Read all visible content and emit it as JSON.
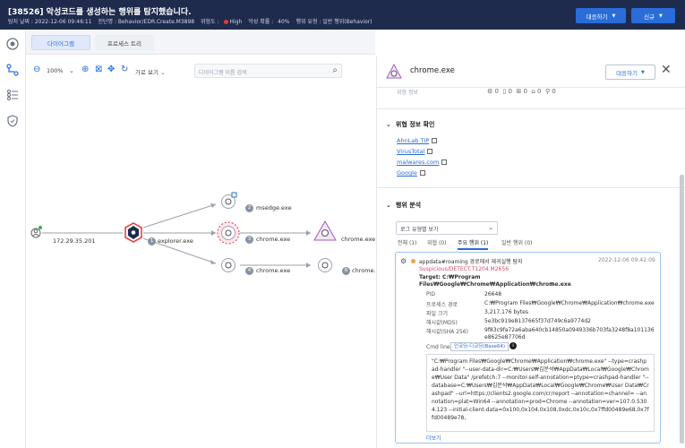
{
  "header": {
    "title": "[38526] 악성코드를 생성하는 행위를 탐지했습니다.",
    "meta": {
      "detect_time": "탐지 날짜 : 2022-12-06 09:46:11",
      "diagnosis": "진단명 : Behavior/EDR.Create.M3898",
      "risk_label": "위험도 :",
      "risk_value": "High",
      "probability_label": "악성 확률 :",
      "probability_value": "40%",
      "behavior_type": "행위 유형 : 일반 행위(Behavior)"
    },
    "next_button": "대응하기",
    "new_button": "신규"
  },
  "tabs": [
    "다이어그램",
    "프로세스 트리"
  ],
  "toolbar": {
    "zoom": "100%",
    "layout": "가로 보기",
    "search_placeholder": "다이어그램 이름 검색"
  },
  "graph": {
    "ip": "172.29.35.201",
    "nodes": [
      {
        "num": "1",
        "label": "explorer.exe"
      },
      {
        "num": "2",
        "label": "msedge.exe"
      },
      {
        "num": "3",
        "label": "chrome.exe"
      },
      {
        "num": "4",
        "label": "chrome.exe"
      },
      {
        "num": "5",
        "label": "chrome.exe"
      },
      {
        "num": "6",
        "label": "chrome.exe"
      }
    ]
  },
  "panel": {
    "process_name": "chrome.exe",
    "respond_button": "대응하기",
    "top_partial": "위험 정보",
    "threat_section": "위협 정보 확인",
    "threat_links": [
      "AhnLab TIP",
      "VirusTotal",
      "malwares.com",
      "Google"
    ],
    "behavior_section": "행위 분석",
    "log_select": "로그 유형별 보기",
    "filter_tabs": [
      "전체 (1)",
      "위협 (0)",
      "주요 행위 (1)",
      "일반 행위 (0)"
    ],
    "event": {
      "title": "appdata#roaming 경로에서 재귀실행 탐지",
      "time": "2022-12-06 09:42:09",
      "rule": "Suspicious/DETECT.T1204.M2656",
      "target": "Target: C:₩Program Files₩Google₩Chrome₩Application₩chrome.exe",
      "fields": [
        {
          "k": "PID",
          "v": "26648"
        },
        {
          "k": "프로세스 경로",
          "v": "C:₩Program Files₩Google₩Chrome₩Application₩chrome.exe"
        },
        {
          "k": "파일 크기",
          "v": "3,217,176 bytes"
        },
        {
          "k": "해시값(MD5)",
          "v": "5e3bc919e8137665f37d749c6a9774d2"
        },
        {
          "k": "해시값(SHA 256)",
          "v": "9f83c9fa72a6aba640cb14850a0949336b703fa3248f8a101136e8625e87706d"
        }
      ],
      "cmd_label": "Cmd line",
      "cmd_decode": "인코딩-디코딩(Base64)",
      "cmd_text": "\"C:₩Program Files₩Google₩Chrome₩Application₩chrome.exe\" --type=crashpad-handler \"--user-data-dir=C:₩Users₩김문석₩AppData₩Local₩Google₩Chrome₩User Data\" /prefetch:7 --monitor-self-annotation=ptype=crashpad-handler \"--database=C:₩Users₩김문석₩AppData₩Local₩Google₩Chrome₩User Data₩Crashpad\" --url=https://clients2.google.com/cr/report --annotation=channel= --annotation=plat=Win64 --annotation=prod=Chrome --annotation=ver=107.0.5304.123 --initial-client-data=0x100,0x104,0x108,0xdc,0x10c,0x7ffd00489e68,0x7ffd00489e78,",
      "more": "더보기"
    }
  }
}
